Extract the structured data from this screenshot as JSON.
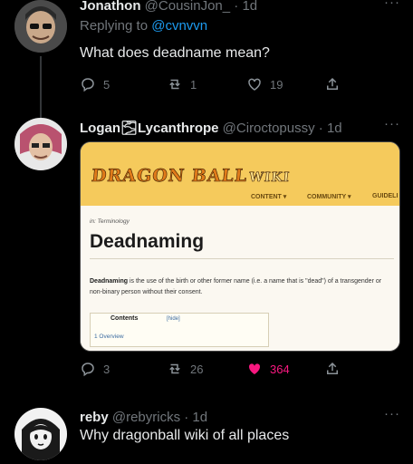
{
  "tweets": [
    {
      "name": "Jonathon",
      "handle": "@CousinJon_",
      "time": "· 1d",
      "reply_prefix": "Replying to ",
      "reply_mention": "@cvnvvn",
      "text": "What does deadname mean?",
      "replies": "5",
      "retweets": "1",
      "likes": "19",
      "more": "···"
    },
    {
      "name": "Logan🌫Lycanthrope",
      "handle": "@Ciroctopussy",
      "time": "· 1d",
      "replies": "3",
      "retweets": "26",
      "likes": "364",
      "more": "···"
    },
    {
      "name": "reby",
      "handle": "@rebyricks",
      "time": "· 1d",
      "text": "Why dragonball wiki of all places",
      "more": "···"
    }
  ],
  "wiki": {
    "logo": "DRAGON BALL",
    "logo_tag": "WIKI",
    "nav": [
      "CONTENT ▾",
      "COMMUNITY ▾",
      "GUIDELI"
    ],
    "crumb": "in: Terminology",
    "heading": "Deadnaming",
    "term": "Deadnaming",
    "definition": " is the use of the birth or other former name (i.e. a name that is \"dead\") of a transgender or non-binary person without their consent.",
    "toc_title": "Contents",
    "toc_hide": "[hide]",
    "toc_item": "1 Overview"
  },
  "colors": {
    "background": "#000000",
    "text": "#e7e9ea",
    "muted": "#71767b",
    "link": "#1d9bf0",
    "like_active": "#f91880",
    "wiki_header": "#f5ca5c"
  }
}
